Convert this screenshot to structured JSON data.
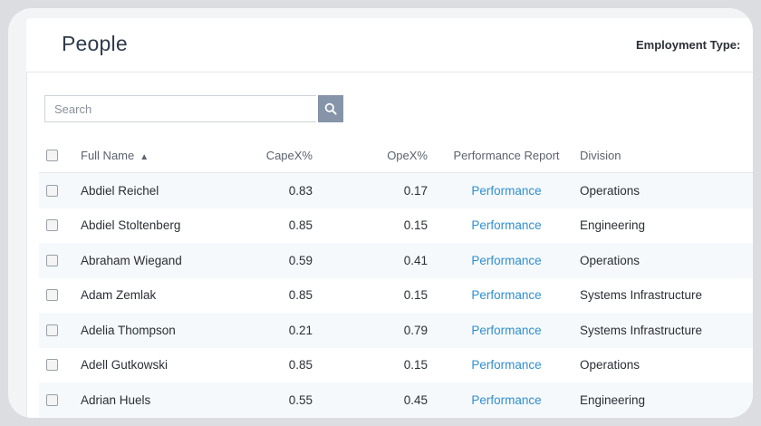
{
  "page": {
    "title": "People",
    "employment_type_label": "Employment Type:"
  },
  "search": {
    "placeholder": "Search"
  },
  "table": {
    "columns": {
      "full_name": "Full Name",
      "capex": "CapeX%",
      "opex": "OpeX%",
      "performance": "Performance Report",
      "division": "Division"
    },
    "rows": [
      {
        "name": "Abdiel Reichel",
        "capex": "0.83",
        "opex": "0.17",
        "performance": "Performance",
        "division": "Operations"
      },
      {
        "name": "Abdiel Stoltenberg",
        "capex": "0.85",
        "opex": "0.15",
        "performance": "Performance",
        "division": "Engineering"
      },
      {
        "name": "Abraham Wiegand",
        "capex": "0.59",
        "opex": "0.41",
        "performance": "Performance",
        "division": "Operations"
      },
      {
        "name": "Adam Zemlak",
        "capex": "0.85",
        "opex": "0.15",
        "performance": "Performance",
        "division": "Systems Infrastructure"
      },
      {
        "name": "Adelia Thompson",
        "capex": "0.21",
        "opex": "0.79",
        "performance": "Performance",
        "division": "Systems Infrastructure"
      },
      {
        "name": "Adell Gutkowski",
        "capex": "0.85",
        "opex": "0.15",
        "performance": "Performance",
        "division": "Operations"
      },
      {
        "name": "Adrian Huels",
        "capex": "0.55",
        "opex": "0.45",
        "performance": "Performance",
        "division": "Engineering"
      }
    ]
  },
  "colors": {
    "link": "#2f8fd1",
    "search_button": "#8594a8",
    "row_stripe": "#f5f9fb"
  }
}
